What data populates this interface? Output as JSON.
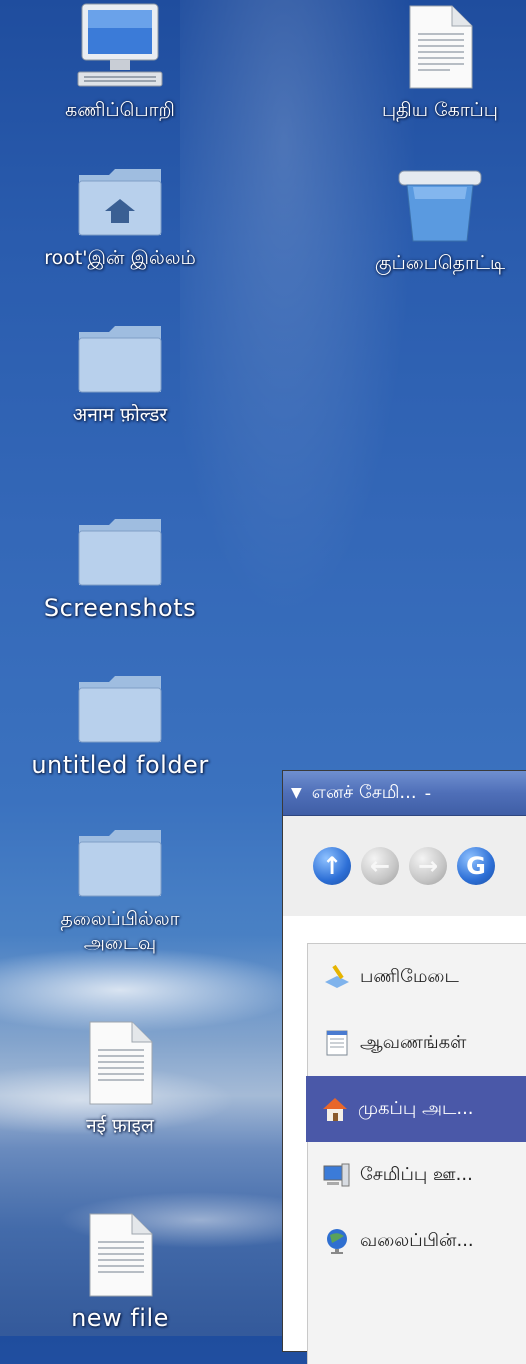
{
  "desktop": {
    "icons": [
      {
        "name": "computer",
        "label": "கணிப்பொறி"
      },
      {
        "name": "new-file-tamil",
        "label": "புதிய கோப்பு"
      },
      {
        "name": "root-home",
        "label": "root'இன் இல்லம்"
      },
      {
        "name": "trash",
        "label": "குப்பைதொட்டி"
      },
      {
        "name": "hindi-folder",
        "label": "अनाम फ़ोल्डर"
      },
      {
        "name": "screenshots",
        "label": "Screenshots"
      },
      {
        "name": "untitled-folder",
        "label": "untitled folder"
      },
      {
        "name": "tamil-untitled-folder",
        "label_line1": "தலைப்பில்லா",
        "label_line2": "அடைவு"
      },
      {
        "name": "hindi-file",
        "label": "नई फ़ाइल"
      },
      {
        "name": "new-file",
        "label": "new file"
      }
    ]
  },
  "window": {
    "title": "எனச் சேமி...",
    "title_suffix": "-",
    "toolbar": {
      "icons": [
        "up-arrow-icon",
        "back-icon",
        "forward-icon",
        "go-icon"
      ]
    },
    "places": [
      {
        "label": "பணிமேடை",
        "icon": "desktop-icon"
      },
      {
        "label": "ஆவணங்கள்",
        "icon": "documents-icon"
      },
      {
        "label": "முகப்பு அட...",
        "icon": "home-icon",
        "selected": true
      },
      {
        "label": "சேமிப்பு ஊ...",
        "icon": "storage-icon"
      },
      {
        "label": "வலைப்பின்...",
        "icon": "network-icon"
      }
    ]
  },
  "colors": {
    "selection": "#4a58a8",
    "titlebar": "#4f6fb8"
  }
}
